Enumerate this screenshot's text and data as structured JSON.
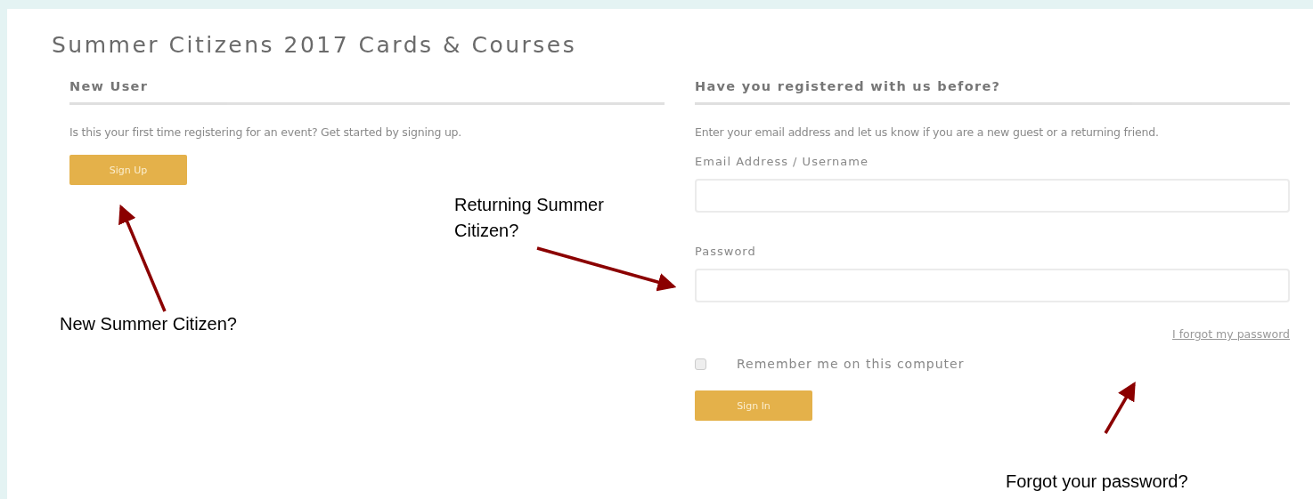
{
  "page_title": "Summer Citizens 2017 Cards & Courses",
  "new_user": {
    "heading": "New User",
    "text": "Is this your first time registering for an event? Get started by signing up.",
    "button": "Sign Up"
  },
  "returning": {
    "heading": "Have you registered with us before?",
    "text": "Enter your email address and let us know if you are a new guest or a returning friend.",
    "email_label": "Email Address / Username",
    "password_label": "Password",
    "forgot_link": "I forgot my password",
    "remember": {
      "label": "Remember me on this computer",
      "checked": false
    },
    "button": "Sign In"
  },
  "annotations": [
    {
      "text": "New Summer Citizen?",
      "kind": "new"
    },
    {
      "text": "Returning Summer Citizen?",
      "kind": "returning"
    },
    {
      "text": "Forgot your password?",
      "kind": "forgot"
    }
  ]
}
